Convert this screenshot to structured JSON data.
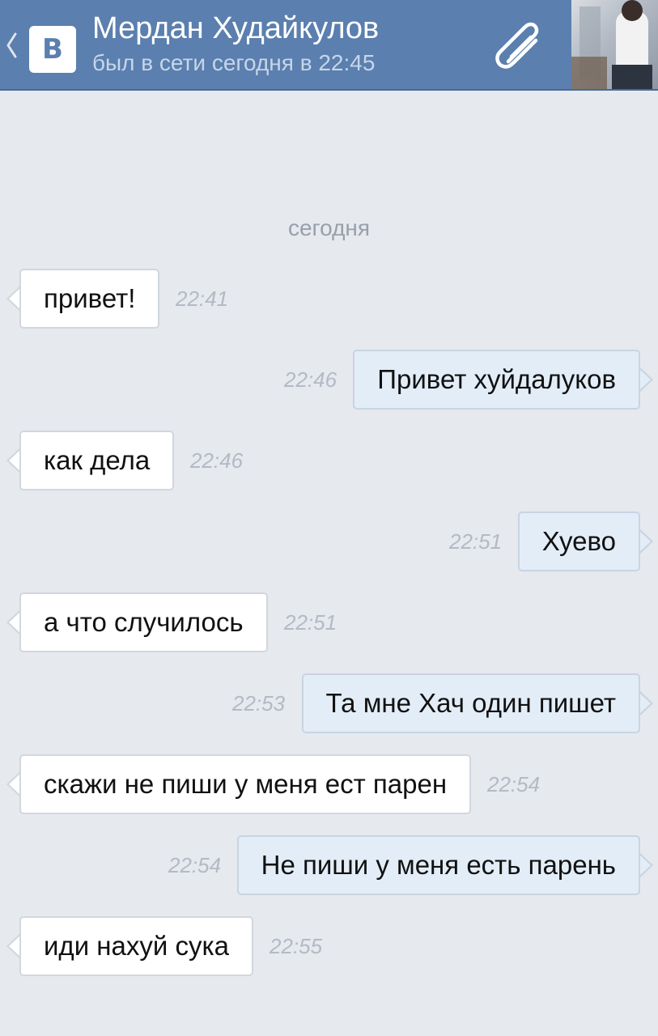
{
  "header": {
    "back_icon": "chevron-left-icon",
    "logo_letter": "В",
    "contact_name": "Мердан Худайкулов",
    "status": "был в сети сегодня в 22:45",
    "attach_icon": "paperclip-icon",
    "accent_color": "#5b7fae"
  },
  "chat": {
    "date_separator": "сегодня",
    "messages": [
      {
        "direction": "in",
        "text": "привет!",
        "time": "22:41"
      },
      {
        "direction": "out",
        "text": "Привет хуйдалуков",
        "time": "22:46"
      },
      {
        "direction": "in",
        "text": "как дела",
        "time": "22:46"
      },
      {
        "direction": "out",
        "text": "Хуево",
        "time": "22:51"
      },
      {
        "direction": "in",
        "text": "а что случилось",
        "time": "22:51"
      },
      {
        "direction": "out",
        "text": "Та мне Хач один пишет",
        "time": "22:53"
      },
      {
        "direction": "in",
        "text": "скажи не пиши у меня ест парен",
        "time": "22:54"
      },
      {
        "direction": "out",
        "text": "Не пиши у меня есть парень",
        "time": "22:54"
      },
      {
        "direction": "in",
        "text": "иди нахуй сука",
        "time": "22:55"
      }
    ]
  }
}
